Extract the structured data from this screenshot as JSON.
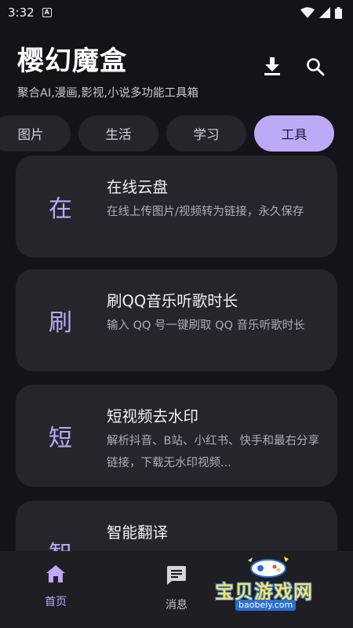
{
  "status_bar": {
    "time": "3:32",
    "notif_letter": "A"
  },
  "header": {
    "title": "樱幻魔盒",
    "subtitle": "聚合AI,漫画,影视,小说多功能工具箱",
    "download_icon": "download-icon",
    "search_icon": "search-icon"
  },
  "tabs": [
    {
      "label": "图片",
      "active": false
    },
    {
      "label": "生活",
      "active": false
    },
    {
      "label": "学习",
      "active": false
    },
    {
      "label": "工具",
      "active": true
    }
  ],
  "cards": [
    {
      "glyph": "在",
      "title": "在线云盘",
      "desc": "在线上传图片/视频转为链接，永久保存"
    },
    {
      "glyph": "刷",
      "title": "刷QQ音乐听歌时长",
      "desc": "输入 QQ 号一键刷取 QQ 音乐听歌时长"
    },
    {
      "glyph": "短",
      "title": "短视频去水印",
      "desc": "解析抖音、B站、小红书、快手和最右分享链接，下载无水印视频..."
    },
    {
      "glyph": "智",
      "title": "智能翻译",
      "desc": ""
    }
  ],
  "bottom_nav": [
    {
      "label": "首页",
      "icon": "home-icon",
      "active": true
    },
    {
      "label": "消息",
      "icon": "message-icon",
      "active": false
    }
  ],
  "watermark": {
    "text": "宝贝游戏网",
    "url": "baobeiy.com"
  },
  "colors": {
    "accent": "#bcaaf7",
    "background": "#141318",
    "card": "#26252b"
  }
}
